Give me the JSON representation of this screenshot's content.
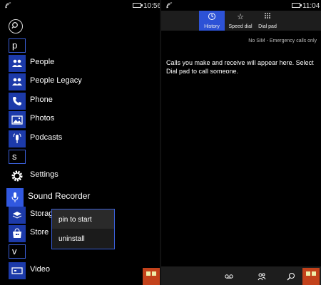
{
  "left": {
    "status": {
      "time": "10:56"
    },
    "search_icon": "search-icon",
    "apps": [
      {
        "letter": "p"
      },
      {
        "name": "People",
        "icon": "people-icon"
      },
      {
        "name": "People Legacy",
        "icon": "people-legacy-icon"
      },
      {
        "name": "Phone",
        "icon": "phone-icon"
      },
      {
        "name": "Photos",
        "icon": "photos-icon"
      },
      {
        "name": "Podcasts",
        "icon": "podcasts-icon"
      },
      {
        "letter": "s"
      },
      {
        "name": "Settings",
        "icon": "gear-icon"
      },
      {
        "name": "Sound Recorder",
        "icon": "microphone-icon"
      },
      {
        "name": "Storage",
        "icon": "storage-icon"
      },
      {
        "name": "Store",
        "icon": "store-icon"
      },
      {
        "letter": "v"
      },
      {
        "name": "Video",
        "icon": "video-icon"
      }
    ],
    "context_menu": {
      "pin": "pin to start",
      "uninstall": "uninstall"
    }
  },
  "right": {
    "status": {
      "time": "11:04"
    },
    "tabs": [
      {
        "label": "History",
        "icon": "history-icon",
        "active": true
      },
      {
        "label": "Speed dial",
        "icon": "star-icon",
        "active": false
      },
      {
        "label": "Dial pad",
        "icon": "dialpad-icon",
        "active": false
      }
    ],
    "sim_note": "No SIM - Emergency calls only",
    "empty_message": "Calls you make and receive will appear here. Select Dial pad to call someone.",
    "bottom_icons": [
      "voicemail-icon",
      "contacts-icon",
      "search-icon",
      "more-icon"
    ]
  },
  "colors": {
    "accent": "#2d52d6",
    "tile": "#1c3aa9",
    "background": "#000000"
  }
}
